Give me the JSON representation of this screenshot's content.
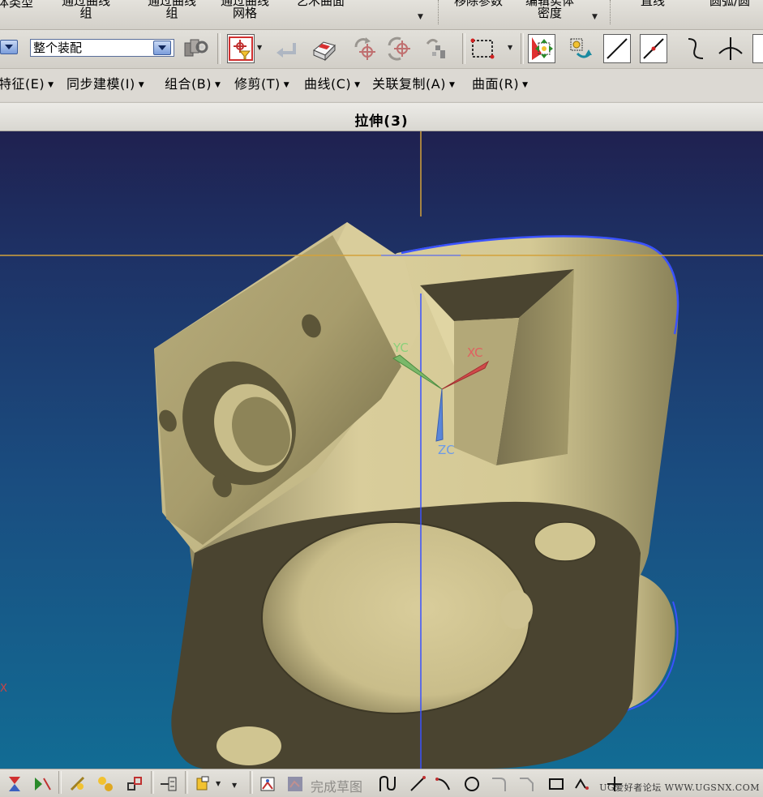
{
  "ribbon": {
    "items": [
      {
        "line1": "体类型",
        "line2": ""
      },
      {
        "line1": "通过曲线",
        "line2": "组"
      },
      {
        "line1": "通过曲线",
        "line2": "组"
      },
      {
        "line1": "通过曲线",
        "line2": "网格"
      },
      {
        "line1": "艺术曲面",
        "line2": ""
      },
      {
        "line1": "移除参数",
        "line2": ""
      },
      {
        "line1": "编辑实体",
        "line2": "密度"
      },
      {
        "line1": "直线",
        "line2": ""
      },
      {
        "line1": "圆弧/圆",
        "line2": ""
      }
    ]
  },
  "toolbar": {
    "assembly_select": "整个装配",
    "icons": [
      "filter-dropdown-icon",
      "assembly-selection-icon",
      "snap-point-icon",
      "undo-arrow-icon",
      "view-section-icon",
      "rotate-point-icon",
      "move-point-icon",
      "point-cloud-icon",
      "rectangle-select-icon",
      "select-all-icon",
      "transform-icon",
      "line-icon",
      "line-point-icon",
      "curve-icon",
      "perpendicular-icon"
    ]
  },
  "menu": {
    "items": [
      {
        "label": "特征(E)"
      },
      {
        "label": "同步建模(I)"
      },
      {
        "label": "组合(B)"
      },
      {
        "label": "修剪(T)"
      },
      {
        "label": "曲线(C)"
      },
      {
        "label": "关联复制(A)"
      },
      {
        "label": "曲面(R)"
      }
    ]
  },
  "dialog": {
    "title": "拉伸(3)"
  },
  "viewport": {
    "background_top": "#1f2150",
    "background_bottom": "#126c94",
    "part_color": "#c8bd8c",
    "part_shadow": "#4a4430",
    "edge_highlight": "#3a52ff",
    "crosshair_color": "#d4a23a",
    "triad": {
      "xc_label": "XC",
      "yc_label": "YC",
      "zc_label": "ZC",
      "xc_color": "#d04a4a",
      "yc_color": "#7ab86a",
      "zc_color": "#5a86d8"
    },
    "edge_marker": "X"
  },
  "bottom_bar": {
    "finish_sketch_label": "完成草图",
    "watermark": "UG爱好者论坛 WWW.UGSNX.COM"
  }
}
